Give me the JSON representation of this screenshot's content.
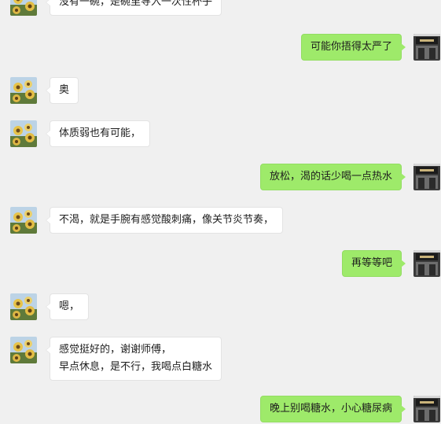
{
  "colors": {
    "background": "#f0f0f0",
    "incoming_bubble": "#ffffff",
    "outgoing_bubble": "#9eea6a"
  },
  "messages": [
    {
      "side": "left",
      "lines": [
        "没有一碗，是碗里导入一次性杯子"
      ]
    },
    {
      "side": "right",
      "lines": [
        "可能你捂得太严了"
      ]
    },
    {
      "side": "left",
      "lines": [
        "奥"
      ]
    },
    {
      "side": "left",
      "lines": [
        "体质弱也有可能，"
      ]
    },
    {
      "side": "right",
      "lines": [
        "放松，渴的话少喝一点热水"
      ]
    },
    {
      "side": "left",
      "lines": [
        "不渴，就是手腕有感觉酸刺痛，像关节炎节奏，"
      ]
    },
    {
      "side": "right",
      "lines": [
        "再等等吧"
      ]
    },
    {
      "side": "left",
      "lines": [
        "嗯，"
      ]
    },
    {
      "side": "left",
      "lines": [
        "感觉挺好的，谢谢师傅，",
        "早点休息，是不行，我喝点白糖水"
      ]
    },
    {
      "side": "right",
      "lines": [
        "晚上别喝糖水，小心糖尿病"
      ]
    }
  ],
  "avatars": {
    "contact": "sunflower-photo-avatar",
    "self": "shop-sign-avatar"
  }
}
